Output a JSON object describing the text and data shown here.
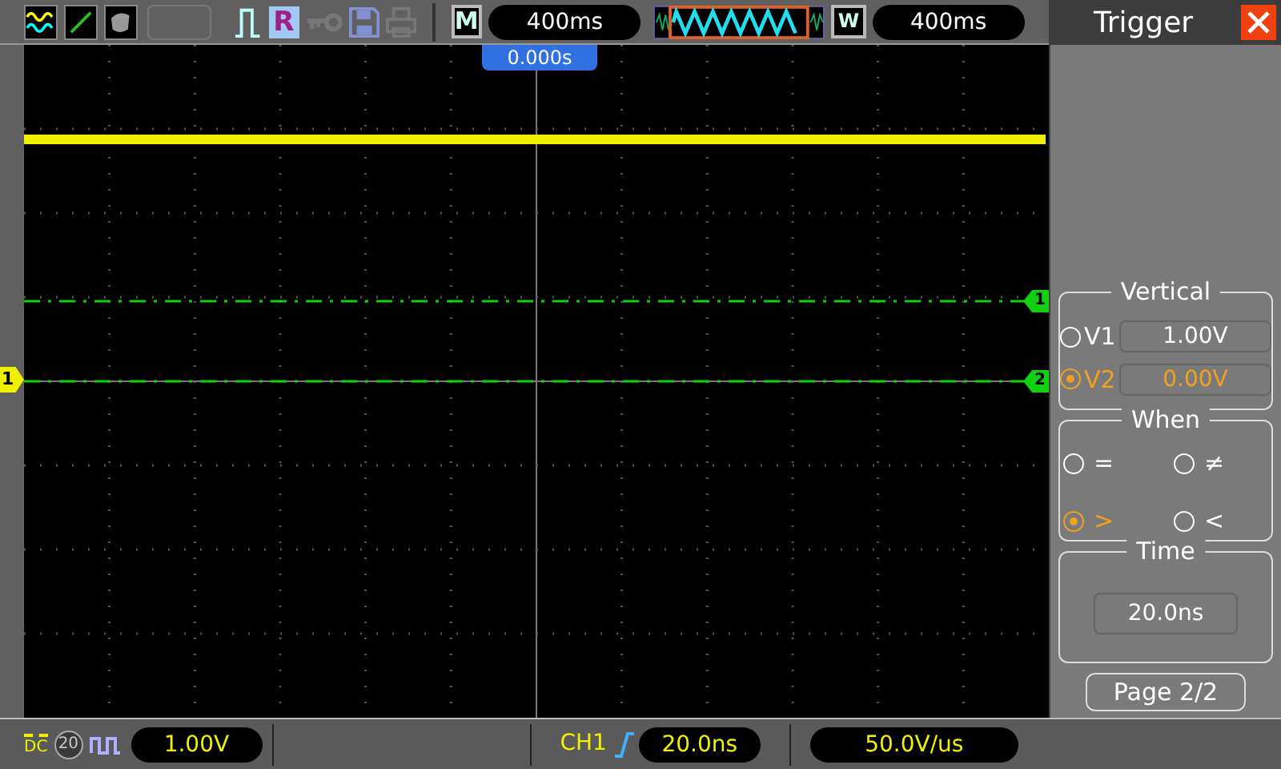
{
  "toolbar": {
    "mode_letter": "R",
    "main_label": "M",
    "main_time": "400ms",
    "window_label": "W",
    "window_time": "400ms"
  },
  "screen": {
    "trigger_time": "0.000s",
    "ch1_marker": "1",
    "level_markers": [
      {
        "label": "1"
      },
      {
        "label": "2"
      }
    ]
  },
  "panel": {
    "title": "Trigger",
    "vertical": {
      "title": "Vertical",
      "options": [
        {
          "label": "V1",
          "value": "1.00V",
          "selected": false
        },
        {
          "label": "V2",
          "value": "0.00V",
          "selected": true
        }
      ]
    },
    "when": {
      "title": "When",
      "options": [
        {
          "label": "=",
          "selected": false
        },
        {
          "label": "≠",
          "selected": false
        },
        {
          "label": ">",
          "selected": true
        },
        {
          "label": "<",
          "selected": false
        }
      ]
    },
    "time": {
      "title": "Time",
      "value": "20.0ns"
    },
    "page_button": "Page 2/2"
  },
  "status_bar": {
    "coupling": "DC",
    "bw_limit": "20",
    "volts_div": "1.00V",
    "trigger_source": "CH1",
    "trigger_value": "20.0ns",
    "slew_rate": "50.0V/us"
  }
}
